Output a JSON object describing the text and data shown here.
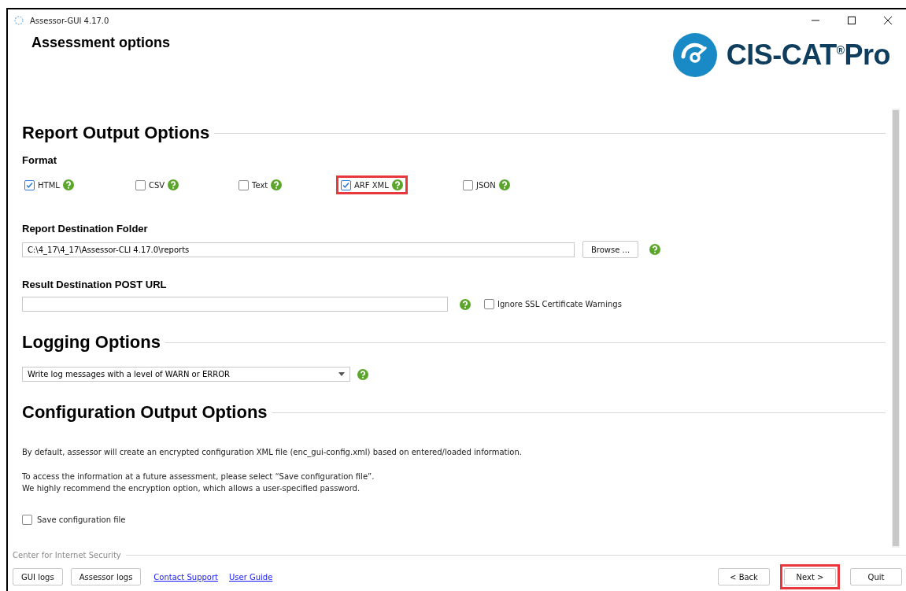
{
  "window": {
    "title": "Assessor-GUI 4.17.0"
  },
  "header": {
    "title": "Assessment options",
    "logo": "CIS-CAT$^{®}$Pro"
  },
  "report_output": {
    "heading": "Report Output Options",
    "format_label": "Format",
    "formats": [
      {
        "label": "HTML",
        "checked": true,
        "highlighted": false
      },
      {
        "label": "CSV",
        "checked": false,
        "highlighted": false
      },
      {
        "label": "Text",
        "checked": false,
        "highlighted": false
      },
      {
        "label": "ARF XML",
        "checked": true,
        "highlighted": true
      },
      {
        "label": "JSON",
        "checked": false,
        "highlighted": false
      }
    ],
    "folder_label": "Report Destination Folder",
    "folder_value": "C:\\4_17\\4_17\\Assessor-CLI 4.17.0\\reports",
    "browse_button": "Browse ...",
    "post_url_label": "Result Destination POST URL",
    "ignore_ssl": {
      "label": "Ignore SSL Certificate Warnings",
      "checked": false
    }
  },
  "logging": {
    "heading": "Logging Options",
    "level": "Write log messages with a level of WARN or ERROR"
  },
  "configuration_output": {
    "heading": "Configuration Output Options",
    "paragraphs": [
      "By default, assessor will create an encrypted configuration XML file (enc_gui-config.xml) based on entered/loaded information.",
      "To access the information at a future assessment, please select “Save configuration file”.\nWe highly recommend the encryption option, which allows a user-specified password."
    ],
    "save_config": {
      "label": "Save configuration file",
      "checked": false
    }
  },
  "footer": {
    "group_label": "Center for Internet Security",
    "left_buttons": [
      {
        "label": "GUI logs"
      },
      {
        "label": "Assessor logs"
      }
    ],
    "links": [
      "Contact Support",
      "User Guide"
    ],
    "nav_buttons": [
      {
        "label": "< Back",
        "highlighted": false
      },
      {
        "label": "Next >",
        "highlighted": true
      },
      {
        "label": "Quit",
        "highlighted": false
      }
    ]
  }
}
